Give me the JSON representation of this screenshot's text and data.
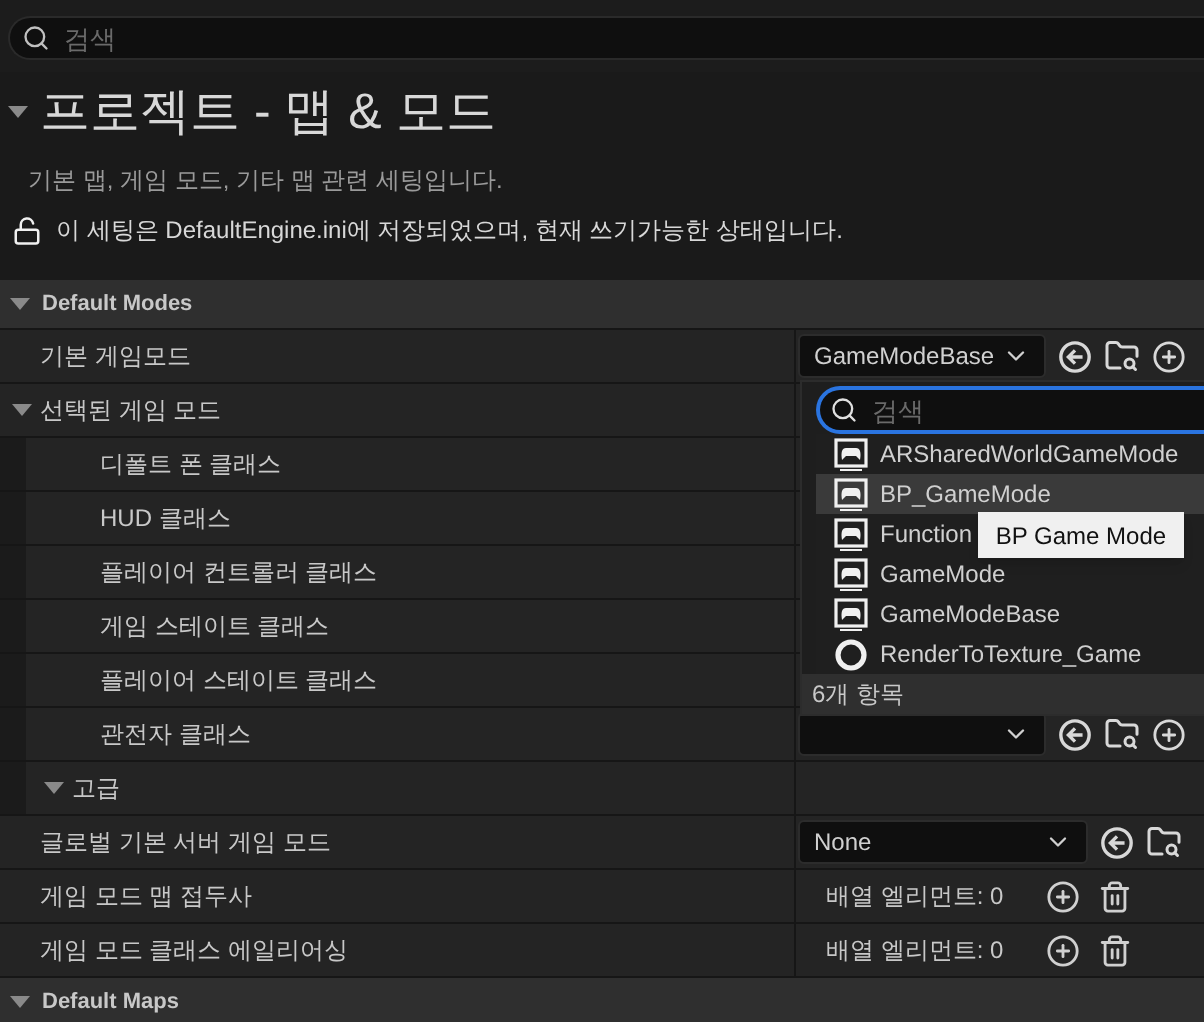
{
  "search": {
    "placeholder": "검색"
  },
  "header": {
    "title": "프로젝트 - 맵 & 모드",
    "expanded": true,
    "description": "기본 맵, 게임 모드, 기타 맵 관련 세팅입니다.",
    "lock_notice": "이 세팅은 DefaultEngine.ini에 저장되었으며, 현재 쓰기가능한 상태입니다."
  },
  "sections": [
    {
      "title": "Default Modes",
      "expanded": true,
      "rows": [
        {
          "kind": "class_addable",
          "label": "기본 게임모드",
          "value": "GameModeBase"
        },
        {
          "kind": "group",
          "label": "선택된 게임 모드",
          "expanded": true,
          "children": [
            {
              "kind": "label",
              "label": "디폴트 폰 클래스"
            },
            {
              "kind": "label",
              "label": "HUD 클래스"
            },
            {
              "kind": "label",
              "label": "플레이어 컨트롤러 클래스"
            },
            {
              "kind": "label",
              "label": "게임 스테이트 클래스"
            },
            {
              "kind": "label",
              "label": "플레이어 스테이트 클래스"
            },
            {
              "kind": "class_addable",
              "label": "관전자 클래스"
            },
            {
              "kind": "group",
              "label": "고급",
              "expanded": true
            }
          ]
        },
        {
          "kind": "class",
          "label": "글로벌 기본 서버 게임 모드",
          "value": "None"
        },
        {
          "kind": "array",
          "label": "게임 모드 맵 접두사",
          "value": "배열 엘리먼트: 0"
        },
        {
          "kind": "array",
          "label": "게임 모드 클래스 에일리어싱",
          "value": "배열 엘리먼트: 0"
        }
      ]
    },
    {
      "title": "Default Maps",
      "expanded": true
    }
  ],
  "picker": {
    "search_placeholder": "검색",
    "items": [
      {
        "label": "ARSharedWorldGameMode",
        "kind": "gamemode",
        "highlighted": false
      },
      {
        "label": "BP_GameMode",
        "kind": "gamemode",
        "highlighted": true
      },
      {
        "label": "Function",
        "kind": "gamemode",
        "highlighted": false
      },
      {
        "label": "GameMode",
        "kind": "gamemode",
        "highlighted": false
      },
      {
        "label": "GameModeBase",
        "kind": "gamemode",
        "highlighted": false
      },
      {
        "label": "RenderToTexture_Game",
        "kind": "other",
        "highlighted": false
      }
    ],
    "count": "6개 항목",
    "tooltip": "BP Game Mode"
  }
}
